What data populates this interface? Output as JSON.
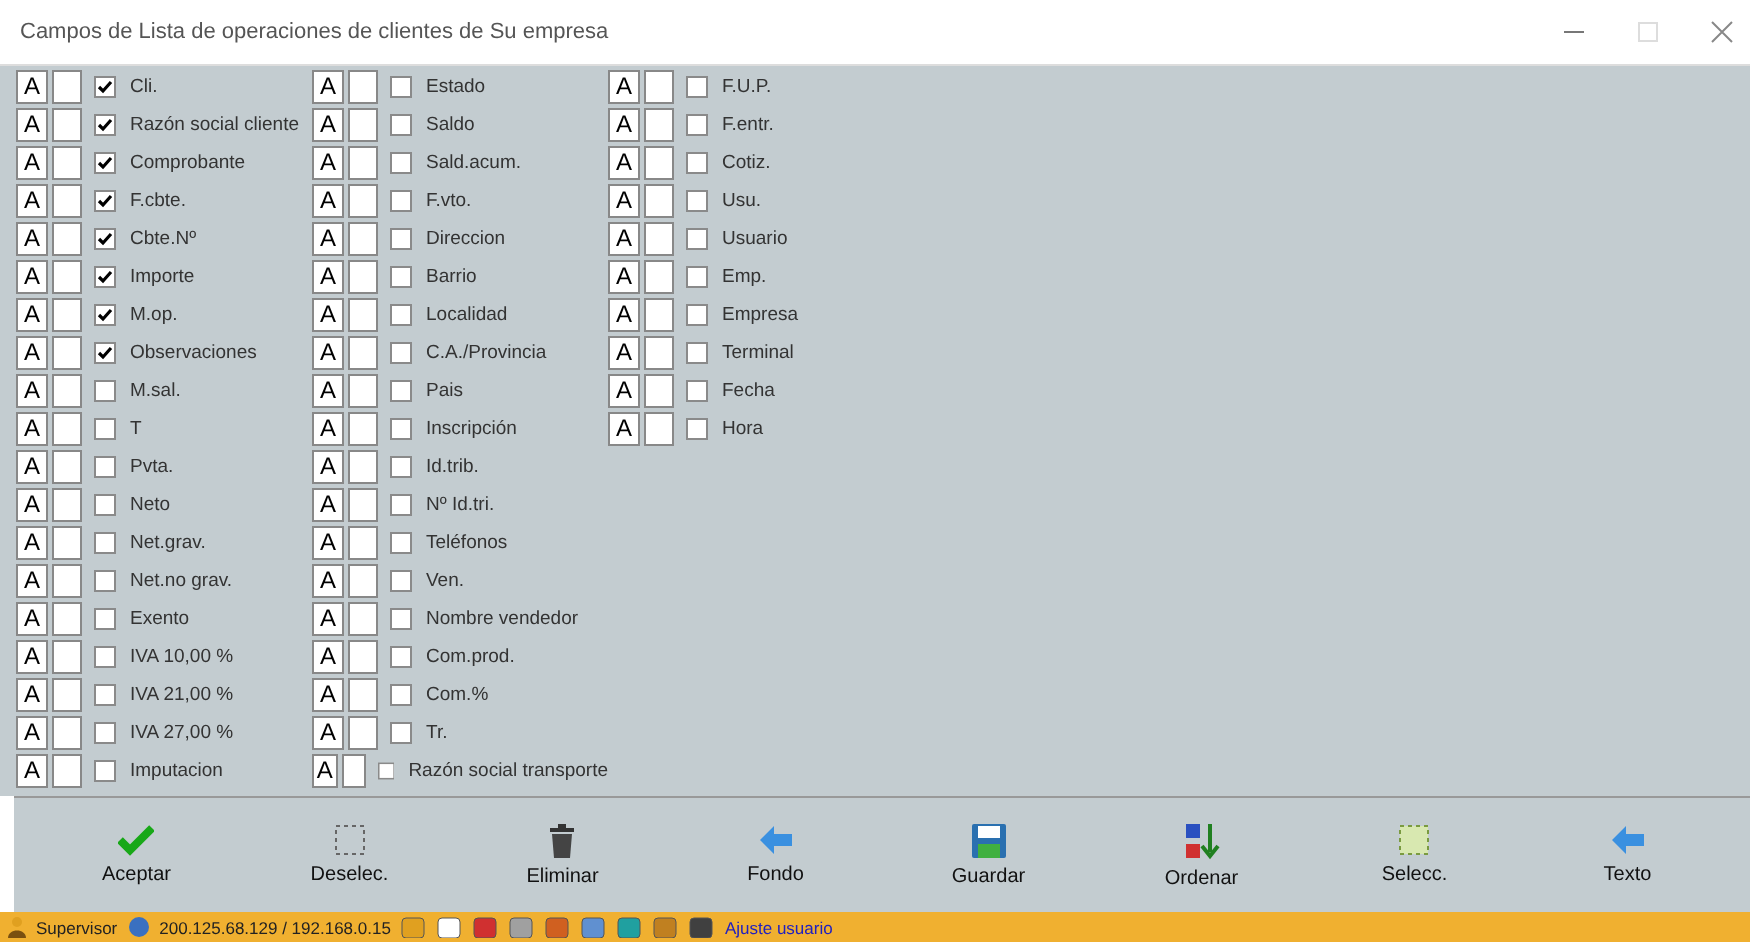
{
  "window": {
    "title": "Campos de Lista de operaciones de clientes de Su empresa"
  },
  "columns": [
    {
      "fields": [
        {
          "format": "A",
          "label": "Cli.",
          "checked": true
        },
        {
          "format": "A",
          "label": "Razón social cliente",
          "checked": true
        },
        {
          "format": "A",
          "label": "Comprobante",
          "checked": true
        },
        {
          "format": "A",
          "label": "F.cbte.",
          "checked": true
        },
        {
          "format": "A",
          "label": "Cbte.Nº",
          "checked": true
        },
        {
          "format": "A",
          "label": "Importe",
          "checked": true
        },
        {
          "format": "A",
          "label": "M.op.",
          "checked": true
        },
        {
          "format": "A",
          "label": "Observaciones",
          "checked": true
        },
        {
          "format": "A",
          "label": "M.sal.",
          "checked": false
        },
        {
          "format": "A",
          "label": "T",
          "checked": false
        },
        {
          "format": "A",
          "label": "Pvta.",
          "checked": false
        },
        {
          "format": "A",
          "label": "Neto",
          "checked": false
        },
        {
          "format": "A",
          "label": "Net.grav.",
          "checked": false
        },
        {
          "format": "A",
          "label": "Net.no grav.",
          "checked": false
        },
        {
          "format": "A",
          "label": "Exento",
          "checked": false
        },
        {
          "format": "A",
          "label": "IVA 10,00 %",
          "checked": false
        },
        {
          "format": "A",
          "label": "IVA 21,00 %",
          "checked": false
        },
        {
          "format": "A",
          "label": "IVA 27,00 %",
          "checked": false
        },
        {
          "format": "A",
          "label": "Imputacion",
          "checked": false
        }
      ]
    },
    {
      "fields": [
        {
          "format": "A",
          "label": "Estado",
          "checked": false
        },
        {
          "format": "A",
          "label": "Saldo",
          "checked": false
        },
        {
          "format": "A",
          "label": "Sald.acum.",
          "checked": false
        },
        {
          "format": "A",
          "label": "F.vto.",
          "checked": false
        },
        {
          "format": "A",
          "label": "Direccion",
          "checked": false
        },
        {
          "format": "A",
          "label": "Barrio",
          "checked": false
        },
        {
          "format": "A",
          "label": "Localidad",
          "checked": false
        },
        {
          "format": "A",
          "label": "C.A./Provincia",
          "checked": false
        },
        {
          "format": "A",
          "label": "Pais",
          "checked": false
        },
        {
          "format": "A",
          "label": "Inscripción",
          "checked": false
        },
        {
          "format": "A",
          "label": "Id.trib.",
          "checked": false
        },
        {
          "format": "A",
          "label": "Nº Id.tri.",
          "checked": false
        },
        {
          "format": "A",
          "label": "Teléfonos",
          "checked": false
        },
        {
          "format": "A",
          "label": "Ven.",
          "checked": false
        },
        {
          "format": "A",
          "label": "Nombre vendedor",
          "checked": false
        },
        {
          "format": "A",
          "label": "Com.prod.",
          "checked": false
        },
        {
          "format": "A",
          "label": "Com.%",
          "checked": false
        },
        {
          "format": "A",
          "label": "Tr.",
          "checked": false
        },
        {
          "format": "A",
          "label": "Razón social transporte",
          "checked": false
        }
      ]
    },
    {
      "fields": [
        {
          "format": "A",
          "label": "F.U.P.",
          "checked": false
        },
        {
          "format": "A",
          "label": "F.entr.",
          "checked": false
        },
        {
          "format": "A",
          "label": "Cotiz.",
          "checked": false
        },
        {
          "format": "A",
          "label": "Usu.",
          "checked": false
        },
        {
          "format": "A",
          "label": "Usuario",
          "checked": false
        },
        {
          "format": "A",
          "label": "Emp.",
          "checked": false
        },
        {
          "format": "A",
          "label": "Empresa",
          "checked": false
        },
        {
          "format": "A",
          "label": "Terminal",
          "checked": false
        },
        {
          "format": "A",
          "label": "Fecha",
          "checked": false
        },
        {
          "format": "A",
          "label": "Hora",
          "checked": false
        }
      ]
    }
  ],
  "toolbar": [
    {
      "kind": "accept",
      "label": "Aceptar"
    },
    {
      "kind": "deselect",
      "label": "Deselec."
    },
    {
      "kind": "delete",
      "label": "Eliminar"
    },
    {
      "kind": "back",
      "label": "Fondo"
    },
    {
      "kind": "save",
      "label": "Guardar"
    },
    {
      "kind": "sort",
      "label": "Ordenar"
    },
    {
      "kind": "select",
      "label": "Selecc."
    },
    {
      "kind": "back",
      "label": "Texto"
    }
  ],
  "status_bar": {
    "user": "Supervisor",
    "address": "200.125.68.129 / 192.168.0.15",
    "link": "Ajuste usuario"
  }
}
